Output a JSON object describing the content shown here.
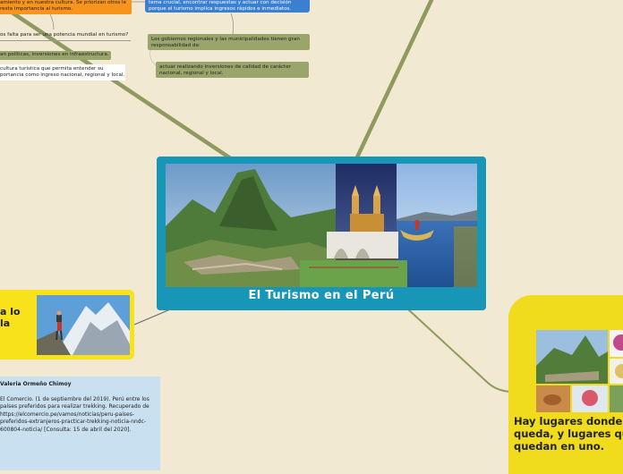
{
  "nodes": {
    "orange": "amiento y en nuestra cultura. Se priorizan otros le resta importancia al turismo.",
    "blue": "tema crucial, encontrar respuestas y actuar con decisión porque el turismo implica ingresos rápidos e inmediatos.",
    "olive_question": "os falta para ser una potencia mundial en turismo?",
    "olive_regional": "Los gobiernos regionales y las municipalidades tienen gran responsabilidad de:",
    "olive_policies": "an políticas, inversiones en infraestructura.",
    "olive_invest": "actuar realizando inversiones de calidad de carácter nacional, regional y local.",
    "white_culture": "cultura turística que permita entender su portancia como ingreso nacional, regional y local."
  },
  "central": {
    "title": "El Turismo en el Perú"
  },
  "yellow_left": {
    "line1": "a lo",
    "line2": "la"
  },
  "yellow_right": {
    "line1": "Hay lugares donde",
    "line2": "queda, y lugares qu",
    "line3": "quedan en uno."
  },
  "reference": {
    "author": "Valeria Ormeño Chimoy",
    "citation": "El Comercio. (1 de septiembre del 2019). Perú entre los países preferidos para realizar trekking. Recuperado de https://elcomercio.pe/vamos/noticias/peru-paises-preferidos-extranjeros-practicar-trekking-noticia-nndc-600804-noticia/ [Consulta: 15 de abril del 2020]."
  },
  "colors": {
    "background": "#f1e9d2",
    "branch": "#8f9a5e",
    "central": "#1796b8",
    "orange": "#f7941d",
    "blue": "#3b7fd0",
    "olive": "#9aa56c",
    "yellow": "#f7e21b",
    "reference": "#c9e0f1"
  }
}
